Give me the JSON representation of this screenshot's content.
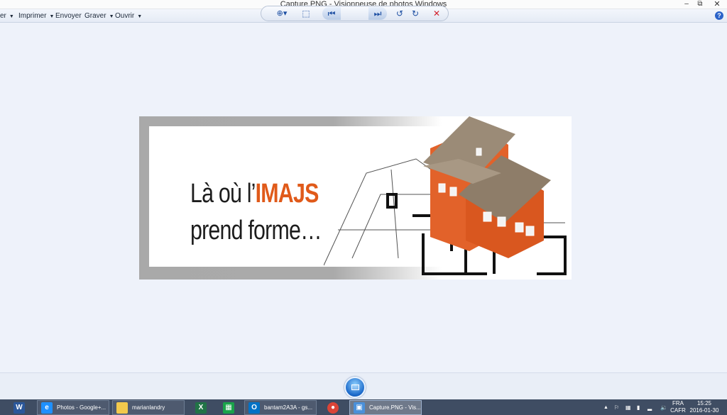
{
  "window": {
    "title": "Capture.PNG - Visionneuse de photos Windows",
    "minimize_glyph": "–",
    "maximize_glyph": "⧉",
    "close_glyph": "✕"
  },
  "menubar": {
    "items": [
      {
        "label": "er",
        "has_dropdown": true
      },
      {
        "label": "Imprimer",
        "has_dropdown": true
      },
      {
        "label": "Envoyer",
        "has_dropdown": false
      },
      {
        "label": "Graver",
        "has_dropdown": true
      },
      {
        "label": "Ouvrir",
        "has_dropdown": true
      }
    ],
    "caret_glyph": "▼",
    "help_glyph": "?"
  },
  "photo": {
    "slogan_line1_prefix": "Là où l’",
    "slogan_line1_accent": "IMAJS",
    "slogan_line2": "prend forme…",
    "accent_color": "#e05a1a"
  },
  "toolbar": {
    "zoom_glyph": "⊕▾",
    "actual_size_glyph": "⬚",
    "previous_glyph": "⏮",
    "next_glyph": "⏭",
    "rotate_left_glyph": "↺",
    "rotate_right_glyph": "↻",
    "delete_glyph": "✕"
  },
  "taskbar": {
    "apps": [
      {
        "label": "",
        "icon_text": "W",
        "icon_color": "#2b579a"
      },
      {
        "label": "Photos - Google+...",
        "icon_text": "e",
        "icon_color": "#1e90ff"
      },
      {
        "label": "marianlandry",
        "icon_text": "",
        "icon_color": "#f2c94c"
      },
      {
        "label": "",
        "icon_text": "X",
        "icon_color": "#217346"
      },
      {
        "label": "",
        "icon_text": "▦",
        "icon_color": "#1aa34a"
      },
      {
        "label": "bantam2A3A - gs...",
        "icon_text": "O",
        "icon_color": "#0072c6"
      },
      {
        "label": "",
        "icon_text": "●",
        "icon_color": "#db4437"
      },
      {
        "label": "Capture.PNG - Vis...",
        "icon_text": "▣",
        "icon_color": "#4a90d9"
      }
    ],
    "tray": {
      "language": "FRA",
      "locale": "CAFR",
      "time": "15:25",
      "date": "2016-01-30",
      "overflow_glyph": "▲"
    }
  }
}
